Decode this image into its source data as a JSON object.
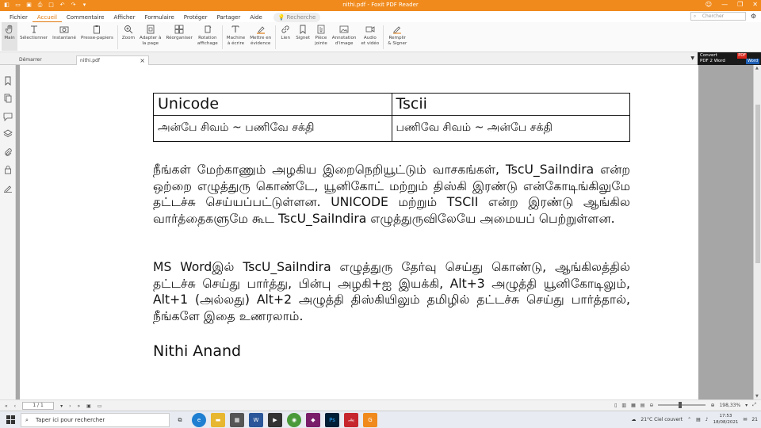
{
  "window": {
    "title": "nithi.pdf - Foxit PDF Reader",
    "controls": [
      "—",
      "❐",
      "✕"
    ]
  },
  "menu": {
    "tabs": [
      "Fichier",
      "Accueil",
      "Commentaire",
      "Afficher",
      "Formulaire",
      "Protéger",
      "Partager",
      "Aide"
    ],
    "active_tab": "Accueil",
    "command_search": "Recherche",
    "search_placeholder": "Chercher"
  },
  "toolbar": {
    "tools": [
      {
        "label": "Main",
        "icon": "hand-icon"
      },
      {
        "label": "Sélectionner",
        "icon": "cursor-icon"
      },
      {
        "label": "Instantané",
        "icon": "snapshot-icon"
      },
      {
        "label": "Presse-papiers",
        "icon": "clipboard-icon"
      },
      {
        "label": "Zoom",
        "icon": "zoom-icon"
      },
      {
        "label": "Adapter à\nla page",
        "icon": "fit-page-icon"
      },
      {
        "label": "Réorganiser",
        "icon": "reorganize-icon"
      },
      {
        "label": "Rotation\naffichage",
        "icon": "rotate-icon"
      },
      {
        "label": "Machine\nà écrire",
        "icon": "typewriter-icon"
      },
      {
        "label": "Mettre en\névidence",
        "icon": "highlight-icon"
      },
      {
        "label": "Lien",
        "icon": "link-icon"
      },
      {
        "label": "Signet",
        "icon": "bookmark-icon"
      },
      {
        "label": "Pièce\njointe",
        "icon": "attachment-icon"
      },
      {
        "label": "Annotation\nd'image",
        "icon": "image-annotation-icon"
      },
      {
        "label": "Audio\net vidéo",
        "icon": "audio-video-icon"
      },
      {
        "label": "Remplir\n& Signer",
        "icon": "fill-sign-icon"
      }
    ]
  },
  "doc_tabs": {
    "start": "Démarrer",
    "file": "nithi.pdf",
    "close": "×"
  },
  "convert_banner": {
    "line1": "Convert",
    "line2": "PDF 2 Word",
    "badge_pdf": "PDF",
    "badge_word": "Word"
  },
  "document": {
    "table": {
      "headers": [
        "Unicode",
        "Tscii"
      ],
      "cells": [
        "அன்பே சிவம் ~ பணிவே சக்தி",
        "பணிவே சிவம் ~ அன்பே சக்தி"
      ]
    },
    "paragraph1": "நீங்கள் மேற்காணும் அழகிய இறைநெறியூட்டும் வாசகங்கள், TscU_SaiIndira என்ற ஒற்றை எழுத்துரு கொண்டே, யூனிகோட் மற்றும் திஸ்கி இரண்டு என்கோடிங்கிலுமே தட்டச்சு செய்யப்பட்டுள்ளன. UNICODE மற்றும் TSCII என்ற இரண்டு ஆங்கில வார்த்தைகளுமே கூட TscU_SaiIndira எழுத்துருவிலேயே அமையப் பெற்றுள்ளன.",
    "paragraph2": "MS Wordஇல் TscU_SaiIndira எழுத்துரு தேர்வு செய்து கொண்டு, ஆங்கிலத்தில் தட்டச்சு செய்து பார்த்து, பின்பு அழகி+ஐ இயக்கி, Alt+3 அழுத்தி யூனிகோடிலும், Alt+1 (அல்லது) Alt+2 அழுத்தி திஸ்கியிலும் தமிழில் தட்டச்சு செய்து பார்த்தால், நீங்களே இதை உணரலாம்.",
    "signature": "Nithi Anand"
  },
  "statusbar": {
    "page": "1 / 1",
    "zoom": "198,33%"
  },
  "taskbar": {
    "search_placeholder": "Taper ici pour rechercher",
    "weather": "21°C  Ciel couvert",
    "time": "17:53",
    "date": "18/08/2021",
    "notif": "21"
  }
}
